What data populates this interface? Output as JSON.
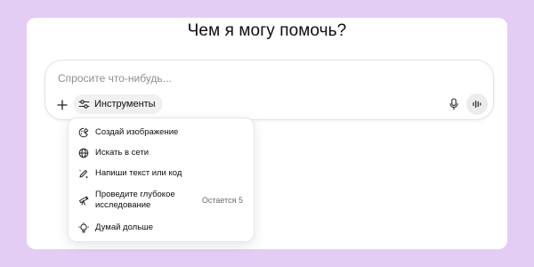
{
  "header": {
    "title": "Чем я могу помочь?"
  },
  "composer": {
    "placeholder": "Спросите что-нибудь...",
    "tools_label": "Инструменты",
    "icons": {
      "plus": "plus-icon",
      "tools": "sliders-icon",
      "mic": "microphone-icon",
      "voice": "voice-waveform-icon"
    }
  },
  "tools_menu": {
    "items": [
      {
        "label": "Создай изображение",
        "icon": "image-palette-icon"
      },
      {
        "label": "Искать в сети",
        "icon": "globe-icon"
      },
      {
        "label": "Напиши текст или код",
        "icon": "pen-sparkle-icon"
      },
      {
        "label_line1": "Проведите глубокое",
        "label_line2": "исследование",
        "badge": "Остается 5",
        "icon": "telescope-icon"
      },
      {
        "label": "Думай дольше",
        "icon": "lightbulb-icon"
      }
    ]
  },
  "colors": {
    "background": "#e4cdf5",
    "surface": "#ffffff",
    "pill": "#f1f1f1",
    "muted_text": "#8f8f8f"
  }
}
